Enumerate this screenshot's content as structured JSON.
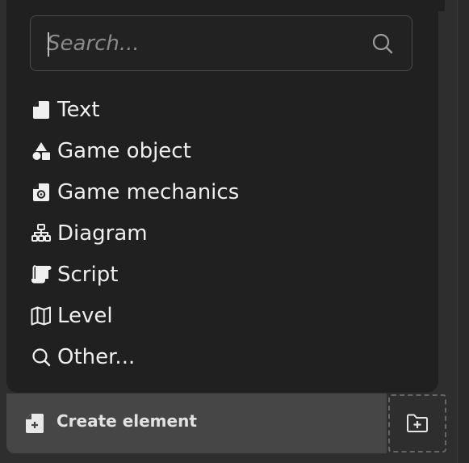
{
  "search": {
    "placeholder": "Search...",
    "value": ""
  },
  "menu": {
    "items": [
      {
        "label": "Text",
        "icon": "file-icon"
      },
      {
        "label": "Game object",
        "icon": "shapes-icon"
      },
      {
        "label": "Game mechanics",
        "icon": "file-gear-icon"
      },
      {
        "label": "Diagram",
        "icon": "sitemap-icon"
      },
      {
        "label": "Script",
        "icon": "scroll-icon"
      },
      {
        "label": "Level",
        "icon": "map-icon"
      },
      {
        "label": "Other...",
        "icon": "search-icon"
      }
    ]
  },
  "footer": {
    "create_label": "Create element",
    "create_icon": "file-plus-icon",
    "folder_icon": "folder-plus-icon"
  },
  "colors": {
    "panel": "#202020",
    "background": "#2e2e2e",
    "button": "#464646",
    "text": "#efefef"
  }
}
